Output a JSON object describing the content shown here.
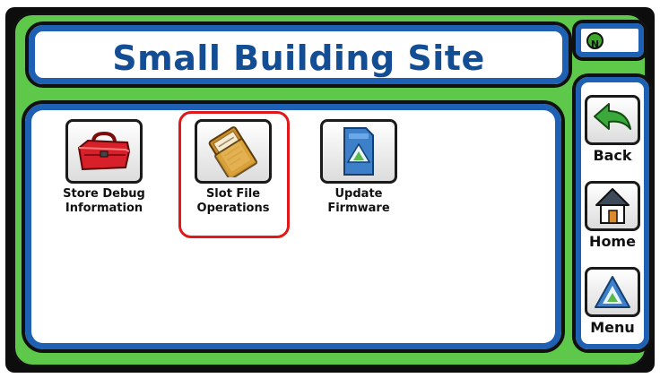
{
  "header": {
    "title": "Small Building Site"
  },
  "status_badge": {
    "letter": "N",
    "color": "#3fa62e"
  },
  "tiles": [
    {
      "line1": "Store Debug",
      "line2": "Information",
      "icon": "toolbox-icon"
    },
    {
      "line1": "Slot File",
      "line2": "Operations",
      "icon": "folder-icon",
      "highlighted": true
    },
    {
      "line1": "Update",
      "line2": "Firmware",
      "icon": "firmware-card-icon"
    }
  ],
  "nav": {
    "back": {
      "label": "Back",
      "icon": "back-arrow-icon"
    },
    "home": {
      "label": "Home",
      "icon": "home-icon"
    },
    "menu": {
      "label": "Menu",
      "icon": "menu-logo-icon"
    }
  },
  "colors": {
    "frame_green": "#5ec84a",
    "panel_blue": "#1e60b4",
    "title_blue": "#134d94",
    "highlight_red": "#e01818"
  }
}
